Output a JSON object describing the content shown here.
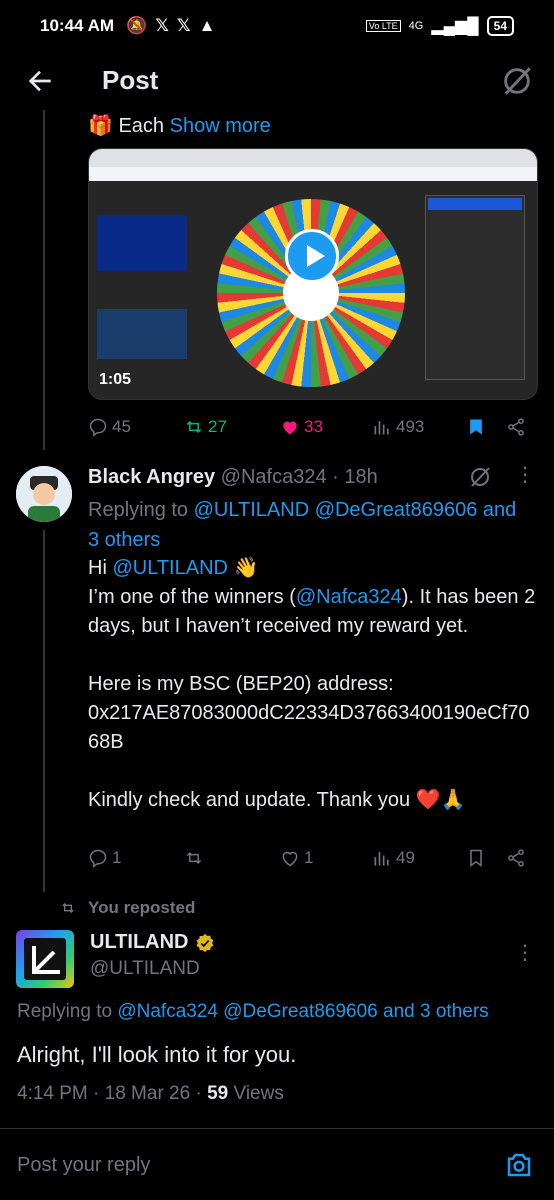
{
  "status": {
    "time": "10:44 AM",
    "battery": "54",
    "network": "4G"
  },
  "header": {
    "title": "Post"
  },
  "prev_tweet": {
    "text_prefix": "Each",
    "show_more": "Show more",
    "video_duration": "1:05",
    "stats": {
      "replies": "45",
      "reposts": "27",
      "likes": "33",
      "views": "493"
    }
  },
  "reply": {
    "display_name": "Black Angrey",
    "handle": "@Nafca324",
    "time": "· 18h",
    "replying_label": "Replying to",
    "replying_users": "@ULTILAND @DeGreat869606",
    "replying_others": "and 3 others",
    "line1_prefix": "Hi",
    "line1_mention": "@ULTILAND",
    "line1_emoji": "👋",
    "line2_a": "I’m one of the winners (",
    "line2_mention": "@Nafca324",
    "line2_b": "). It has been 2 days, but I haven’t received my reward yet.",
    "line3": "Here is my BSC (BEP20) address:",
    "address": "0x217AE87083000dC22334D37663400190eCf7068B",
    "line4": "Kindly check and update. Thank you",
    "line4_emoji": "❤️🙏",
    "stats": {
      "replies": "1",
      "reposts": "",
      "likes": "1",
      "views": "49"
    }
  },
  "repost_note": "You reposted",
  "main_tweet": {
    "display_name": "ULTILAND",
    "handle": "@ULTILAND",
    "replying_label": "Replying to",
    "replying_users": "@Nafca324 @DeGreat869606",
    "replying_others": "and 3 others",
    "text": "Alright, I'll look into it for you.",
    "timestamp": "4:14 PM · 18 Mar 26 ·",
    "views_count": "59",
    "views_label": "Views"
  },
  "reply_box": {
    "placeholder": "Post your reply"
  },
  "colors": {
    "accent": "#1d9bf0",
    "like": "#f91880",
    "repost": "#00ba7c",
    "background": "#000000"
  }
}
